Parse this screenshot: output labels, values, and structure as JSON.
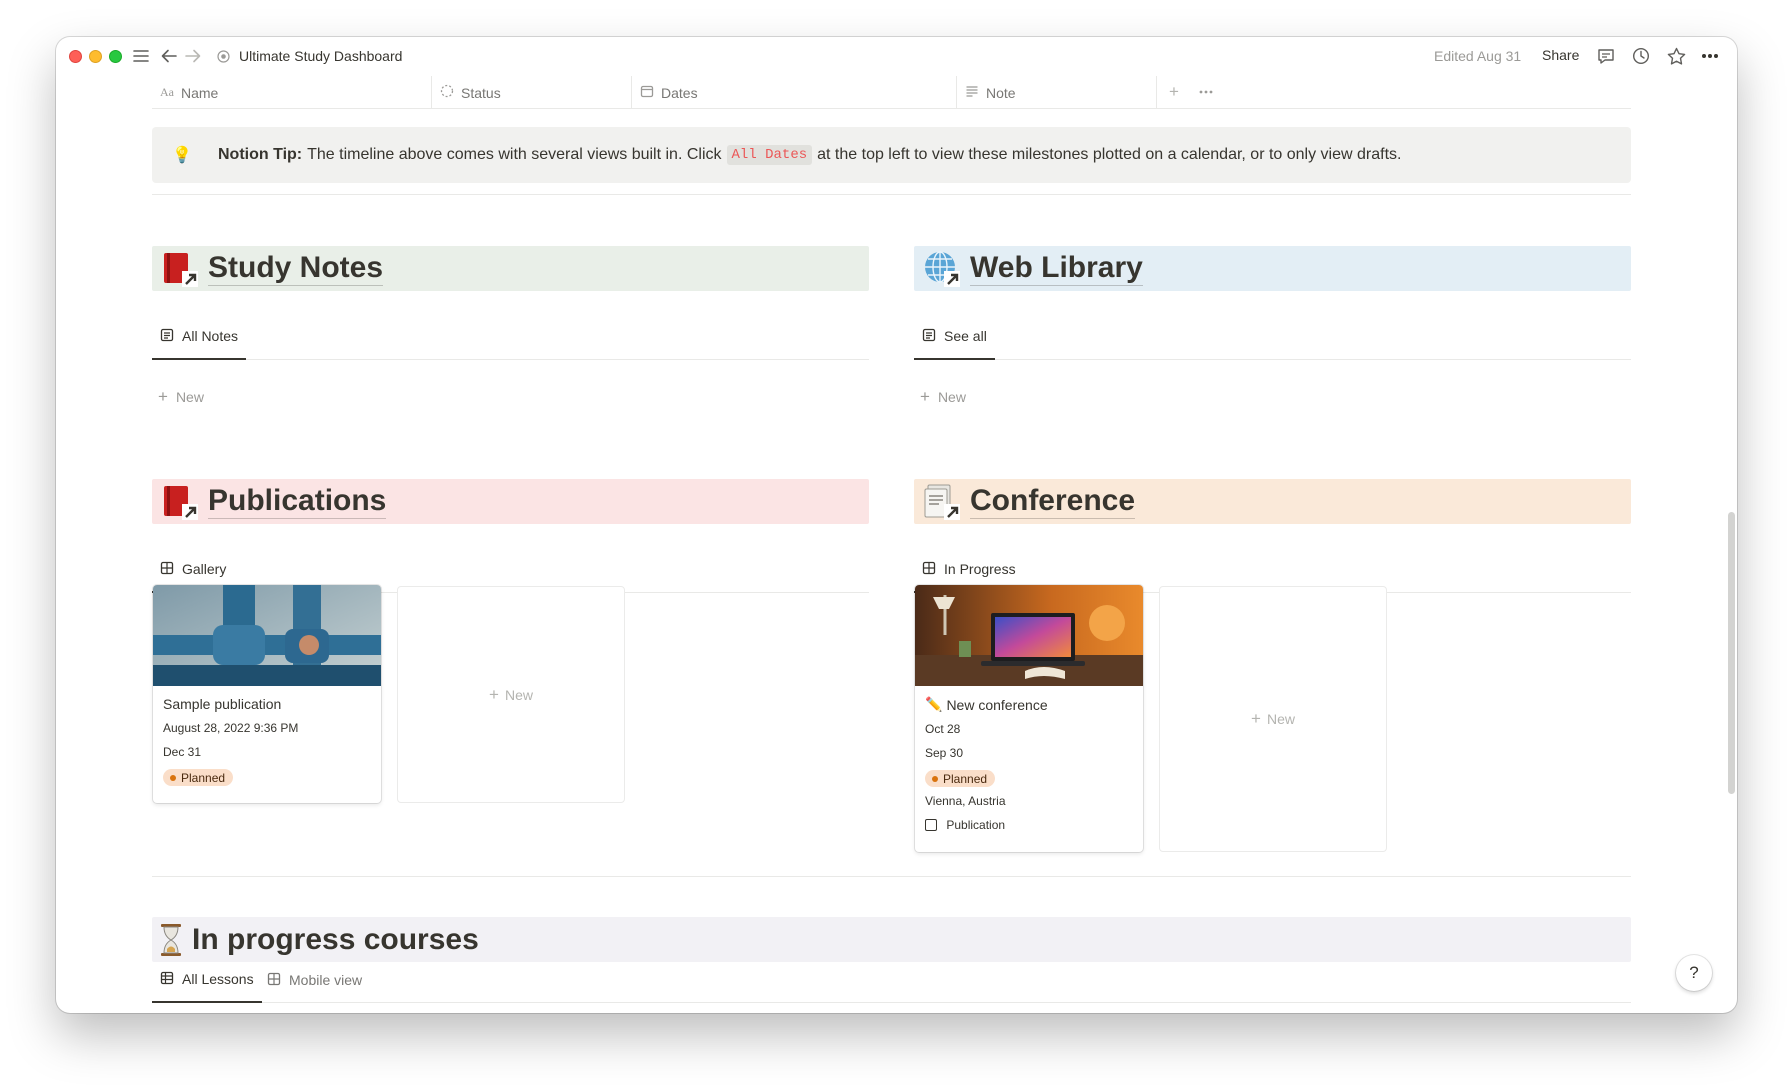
{
  "window": {
    "page_title": "Ultimate Study Dashboard",
    "edited": "Edited Aug 31",
    "share_label": "Share"
  },
  "table_header": {
    "columns": [
      {
        "label": "Name",
        "icon": "text-icon"
      },
      {
        "label": "Status",
        "icon": "status-icon"
      },
      {
        "label": "Dates",
        "icon": "calendar-icon"
      },
      {
        "label": "Note",
        "icon": "note-lines-icon"
      }
    ]
  },
  "tip": {
    "bold": "Notion Tip:",
    "text_before": "The timeline above comes with several views built in. Click",
    "code": "All Dates",
    "text_after": "at the top left to view these milestones plotted on a calendar, or to only view drafts."
  },
  "study_notes": {
    "title": "Study Notes",
    "bg": "#e9efe8",
    "tab": "All Notes",
    "new_label": "New"
  },
  "web_library": {
    "title": "Web Library",
    "bg": "#e3eef5",
    "tab": "See all",
    "new_label": "New"
  },
  "publications": {
    "title": "Publications",
    "bg": "#fbe4e4",
    "tab": "Gallery",
    "card": {
      "title": "Sample publication",
      "created": "August 28, 2022 9:36 PM",
      "date": "Dec 31",
      "status": "Planned"
    },
    "new_label": "New"
  },
  "conference": {
    "title": "Conference",
    "bg": "#fae9d9",
    "tab": "In Progress",
    "card": {
      "title": "New conference",
      "date1": "Oct 28",
      "date2": "Sep 30",
      "status": "Planned",
      "location": "Vienna, Austria",
      "checkbox_label": "Publication"
    },
    "new_label": "New"
  },
  "courses": {
    "title": "In progress courses",
    "bg": "#f2f1f5",
    "tabs": [
      "All Lessons",
      "Mobile view"
    ]
  },
  "help_label": "?",
  "colors": {
    "accent_red": "#eb5757",
    "status_orange": "#d9730d",
    "badge_bg": "#fadec9"
  }
}
